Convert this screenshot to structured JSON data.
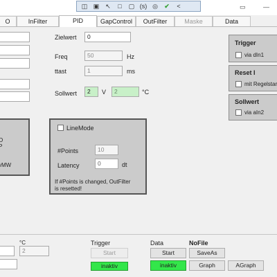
{
  "toolbar": {
    "icons": [
      "window-icon",
      "camera-icon",
      "cursor-icon",
      "frame-icon",
      "pin-icon",
      "s-badge-icon",
      "accessibility-icon",
      "check-icon",
      "chevron-left-icon"
    ],
    "badge_text": "(s)",
    "chevron_text": "<"
  },
  "tabs": [
    {
      "label": "O"
    },
    {
      "label": "InFilter"
    },
    {
      "label": "PID"
    },
    {
      "label": "GapControl"
    },
    {
      "label": "OutFilter"
    },
    {
      "label": "Maske"
    },
    {
      "label": "Data"
    }
  ],
  "pid": {
    "zielwert_label": "Zielwert",
    "zielwert_value": "0",
    "freq_label": "Freq",
    "freq_value": "50",
    "freq_unit": "Hz",
    "ttast_label": "ttast",
    "ttast_value": "1",
    "ttast_unit": "ms",
    "sollwert_label": "Sollwert",
    "sollwert_v": "2",
    "sollwert_v_unit": "V",
    "sollwert_c": "2",
    "sollwert_c_unit": "°C"
  },
  "left_panel_lines": [
    "O",
    "P",
    "vMW"
  ],
  "linemode": {
    "checkbox_label": "LineMode",
    "points_label": "#Points",
    "points_value": "10",
    "latency_label": "Latency",
    "latency_value": "0",
    "latency_unit": "dt",
    "note_line1": "If #Points is changed, OutFilter",
    "note_line2": "is resetted!"
  },
  "right_groups": {
    "trigger_title": "Trigger",
    "trigger_option": "via dIn1",
    "reset_title": "Reset I",
    "reset_option": "mit Regelstar",
    "sollwert_title": "Sollwert",
    "sollwert_option": "via aIn2"
  },
  "bottom": {
    "unit_c": "°C",
    "small_value": "2",
    "trigger_label": "Trigger",
    "trigger_start": "Start",
    "trigger_status": "inaktiv",
    "data_label": "Data",
    "nofile": "NoFile",
    "start": "Start",
    "saveas": "SaveAs",
    "data_status": "inaktiv",
    "graph": "Graph",
    "agraph": "AGraph"
  },
  "colors": {
    "active_green": "#33e64a",
    "input_green": "#c8f0c8",
    "panel_gray": "#cbcbcb"
  }
}
